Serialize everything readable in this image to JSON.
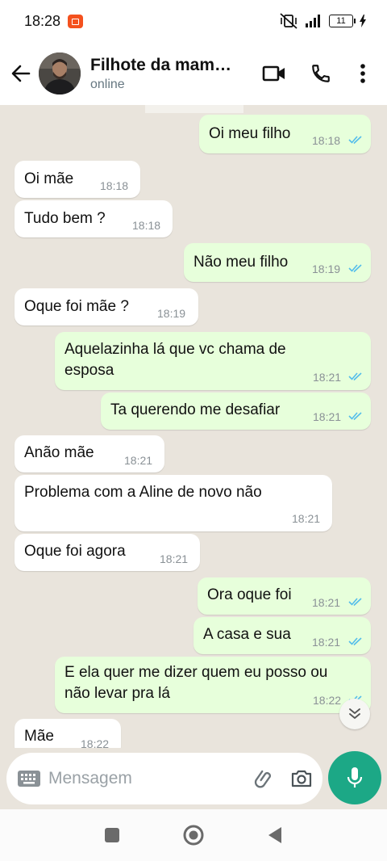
{
  "status_bar": {
    "time": "18:28",
    "battery": "11"
  },
  "header": {
    "contact_name": "Filhote da mam…",
    "contact_status": "online"
  },
  "messages": [
    {
      "dir": "out",
      "text": "Oi meu filho",
      "time": "18:18",
      "read": true
    },
    {
      "dir": "in",
      "text": "Oi mãe",
      "time": "18:18"
    },
    {
      "dir": "in",
      "text": "Tudo bem ?",
      "time": "18:18"
    },
    {
      "dir": "out",
      "text": "Não meu filho",
      "time": "18:19",
      "read": true
    },
    {
      "dir": "in",
      "text": "Oque foi mãe ?",
      "time": "18:19"
    },
    {
      "dir": "out",
      "text": "Aquelazinha lá que vc chama de esposa",
      "time": "18:21",
      "read": true
    },
    {
      "dir": "out",
      "text": "Ta querendo me desafiar",
      "time": "18:21",
      "read": true
    },
    {
      "dir": "in",
      "text": "Anão mãe",
      "time": "18:21"
    },
    {
      "dir": "in",
      "text": "Problema com a Aline de novo não",
      "time": "18:21"
    },
    {
      "dir": "in",
      "text": "Oque foi agora",
      "time": "18:21"
    },
    {
      "dir": "out",
      "text": "Ora oque foi",
      "time": "18:21",
      "read": true
    },
    {
      "dir": "out",
      "text": "A casa e sua",
      "time": "18:21",
      "read": true
    },
    {
      "dir": "out",
      "text": "E ela quer me dizer quem eu posso ou não levar pra lá",
      "time": "18:22",
      "read": true
    },
    {
      "dir": "in",
      "text": "Mãe",
      "time": "18:22"
    }
  ],
  "composer": {
    "placeholder": "Mensagem"
  },
  "colors": {
    "outgoing": "#e7ffdb",
    "incoming": "#ffffff",
    "accent": "#1ca886",
    "read_ticks": "#53bdeb",
    "wallpaper": "#e9e4dc"
  },
  "icons": {
    "back": "arrow-left-icon",
    "video": "video-camera-icon",
    "call": "phone-icon",
    "menu": "more-vertical-icon",
    "keyboard": "keyboard-icon",
    "attach": "paperclip-icon",
    "camera": "camera-icon",
    "mic": "mic-icon",
    "scroll": "double-chevron-down-icon"
  }
}
